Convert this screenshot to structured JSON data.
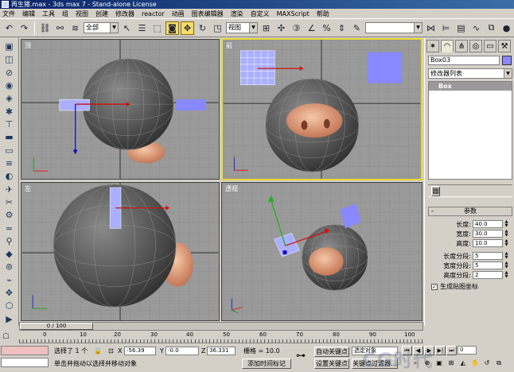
{
  "window": {
    "title": "再生猪.max - 3ds max 7  - Stand-alone License"
  },
  "menu": [
    "文件",
    "编辑",
    "工具",
    "组",
    "视图",
    "创建",
    "修改器",
    "reactor",
    "动画",
    "图表编辑器",
    "渲染",
    "自定义",
    "MAXScript",
    "帮助"
  ],
  "toolbar": {
    "selection_filter": "全部",
    "ref_coord": "视图",
    "named_selection": ""
  },
  "viewports": [
    {
      "label": "顶",
      "active": false
    },
    {
      "label": "前",
      "active": true
    },
    {
      "label": "左",
      "active": false
    },
    {
      "label": "透视",
      "active": false
    }
  ],
  "command_panel": {
    "object_name": "Box03",
    "object_color": "#8888ff",
    "modifier_list": "修改器列表",
    "stack": [
      "Box"
    ],
    "rollout_title": "参数",
    "params": [
      {
        "label": "长度:",
        "value": "40.0"
      },
      {
        "label": "宽度:",
        "value": "30.0"
      },
      {
        "label": "高度:",
        "value": "10.0"
      },
      {
        "label": "长度分段:",
        "value": "5"
      },
      {
        "label": "宽度分段:",
        "value": "5"
      },
      {
        "label": "高度分段:",
        "value": "2"
      }
    ],
    "map_coords_label": "生成贴图坐标"
  },
  "timeline": {
    "slider_text": "0 / 100",
    "tick_labels": [
      "0",
      "10",
      "20",
      "30",
      "40",
      "50",
      "60",
      "70",
      "80",
      "90",
      "100"
    ]
  },
  "status": {
    "selected": "选择了 1 个",
    "x_label": "X",
    "x": "-56.39",
    "y_label": "Y",
    "y": "-0.0",
    "z_label": "Z",
    "z": "36.331",
    "grid": "栅格 = 10.0",
    "prompt": "单击并拖动以选择并移动对象",
    "add_time_tag": "添加时间标记",
    "auto_key": "自动关键点",
    "set_key": "设置关键点",
    "selected_objects": "选定对象",
    "key_filters": "关键点过滤器...",
    "frame": "0"
  },
  "watermark": "CG时代"
}
